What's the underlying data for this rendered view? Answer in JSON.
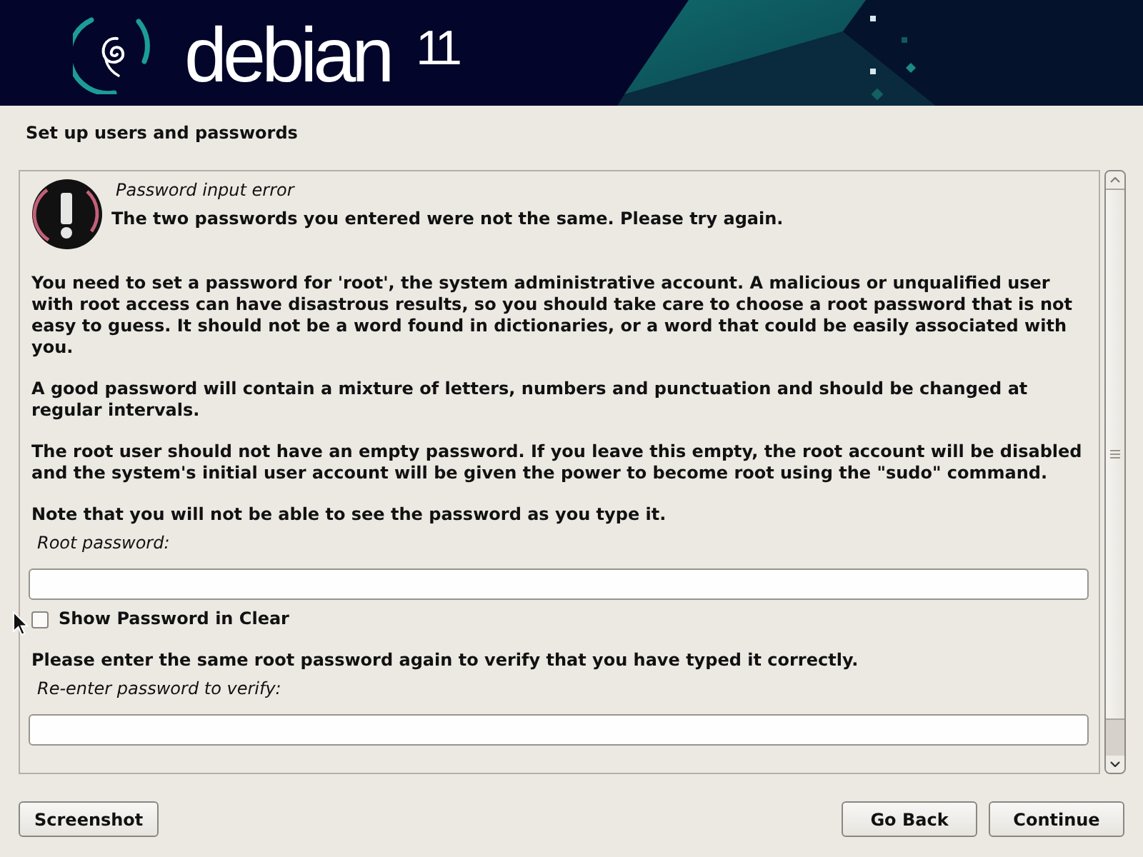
{
  "header": {
    "logo_text": "debian",
    "version": "11"
  },
  "title": "Set up users and passwords",
  "error": {
    "heading": "Password input error",
    "message": "The two passwords you entered were not the same. Please try again."
  },
  "content": [
    {
      "kind": "paragraph",
      "text": "You need to set a password for 'root', the system administrative account. A malicious or unqualified user with root access can have disastrous results, so you should take care to choose a root password that is not easy to guess. It should not be a word found in dictionaries, or a word that could be easily associated with you."
    },
    {
      "kind": "paragraph",
      "text": "A good password will contain a mixture of letters, numbers and punctuation and should be changed at regular intervals."
    },
    {
      "kind": "paragraph",
      "text": "The root user should not have an empty password. If you leave this empty, the root account will be disabled and the system's initial user account will be given the power to become root using the \"sudo\" command."
    },
    {
      "kind": "paragraph",
      "text": "Note that you will not be able to see the password as you type it."
    },
    {
      "kind": "field",
      "label": "Root password:"
    },
    {
      "kind": "checkbox",
      "label": "Show Password in Clear",
      "checked": false
    },
    {
      "kind": "paragraph",
      "text": "Please enter the same root password again to verify that you have typed it correctly."
    },
    {
      "kind": "field",
      "label": "Re-enter password to verify:"
    }
  ],
  "buttons": {
    "left": [
      "Screenshot"
    ],
    "right": [
      "Go Back",
      "Continue"
    ]
  }
}
